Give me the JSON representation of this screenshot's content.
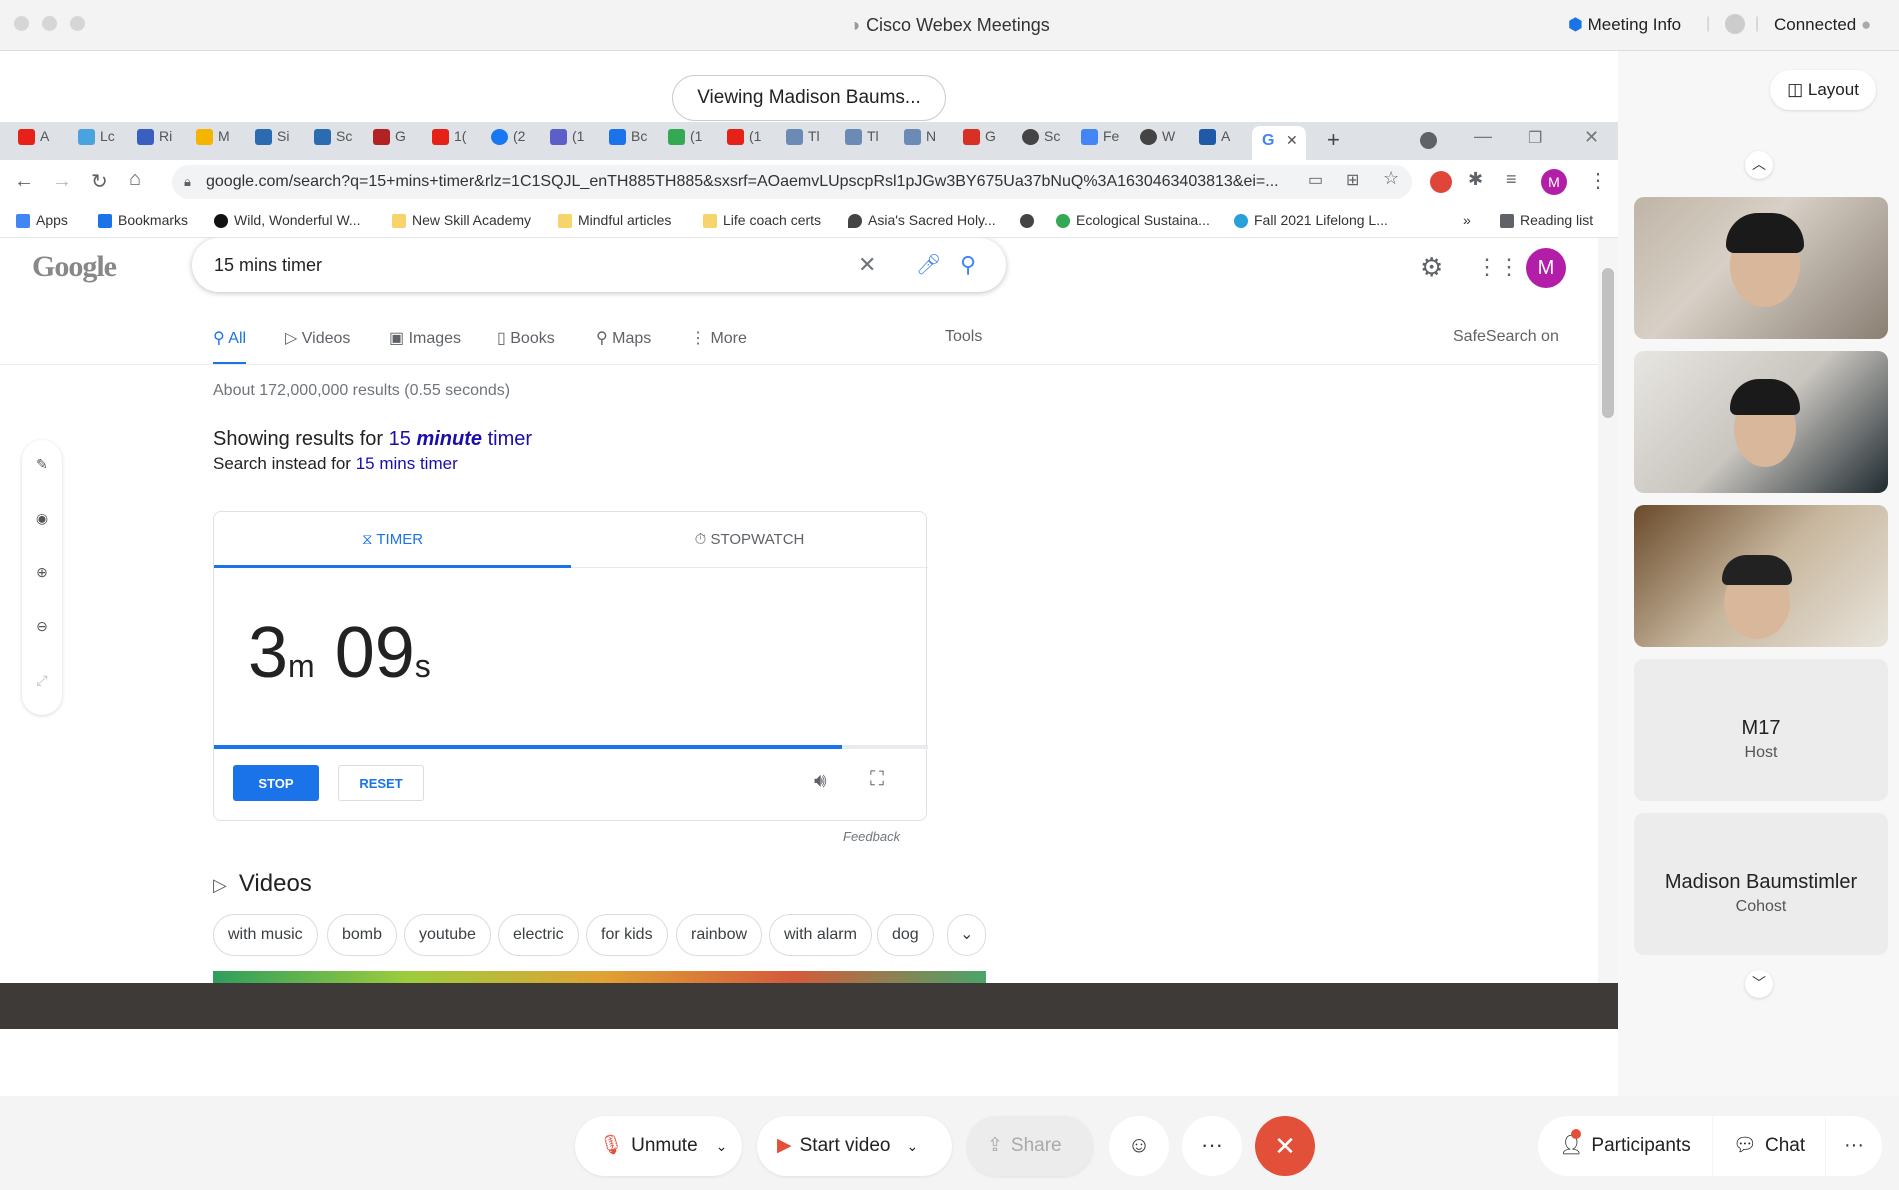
{
  "app": {
    "title": "Cisco Webex Meetings",
    "meeting_info": "Meeting Info",
    "status": "Connected"
  },
  "viewing_label": "Viewing Madison Baums...",
  "layout_label": "Layout",
  "browser": {
    "tabs": [
      "A",
      "Lc",
      "Ri",
      "M",
      "Si",
      "Sc",
      "G",
      "1(",
      "(2",
      "(1",
      "Bc",
      "(1",
      "(1",
      "Tl",
      "Tl",
      "N",
      "G",
      "Sc",
      "Fe",
      "W",
      "A"
    ],
    "active_tab_icon": "google-g-icon",
    "address": "google.com/search?q=15+mins+timer&rlz=1C1SQJL_enTH885TH885&sxsrf=AOaemvLUpscpRsl1pJGw3BY675Ua37bNuQ%3A1630463403813&ei=...",
    "bookmarks": [
      "Apps",
      "Bookmarks",
      "Wild, Wonderful W...",
      "New Skill Academy",
      "Mindful articles",
      "Life coach certs",
      "Asia's Sacred Holy...",
      "Ecological Sustaina...",
      "Fall 2021 Lifelong L..."
    ],
    "reading_list": "Reading list",
    "overflow": "»"
  },
  "google": {
    "logo": "Google",
    "query": "15 mins timer",
    "nav": [
      "All",
      "Videos",
      "Images",
      "Books",
      "Maps",
      "More"
    ],
    "tools": "Tools",
    "safesearch": "SafeSearch on",
    "avatar": "M",
    "results_stat": "About 172,000,000 results (0.55 seconds)",
    "showing_prefix": "Showing results for",
    "showing_num": "15",
    "showing_bold": "minute",
    "showing_rest": "timer",
    "instead_prefix": "Search instead for",
    "instead_link": "15 mins timer",
    "timer": {
      "tab_timer": "TIMER",
      "tab_stopwatch": "STOPWATCH",
      "minutes": "3",
      "min_unit": "m",
      "seconds": "09",
      "sec_unit": "s",
      "progress": 0.88,
      "stop": "STOP",
      "reset": "RESET"
    },
    "feedback": "Feedback",
    "videos_heading": "Videos",
    "chips": [
      "with music",
      "bomb",
      "youtube",
      "electric",
      "for kids",
      "rainbow",
      "with alarm",
      "dog"
    ]
  },
  "participants": [
    {
      "name": "M17",
      "role": "Host"
    },
    {
      "name": "Madison Baumstimler",
      "role": "Cohost"
    }
  ],
  "controls": {
    "unmute": "Unmute",
    "start_video": "Start video",
    "share": "Share",
    "participants": "Participants",
    "chat": "Chat"
  },
  "colors": {
    "accent": "#1a73e8",
    "end_call": "#e3503a"
  }
}
